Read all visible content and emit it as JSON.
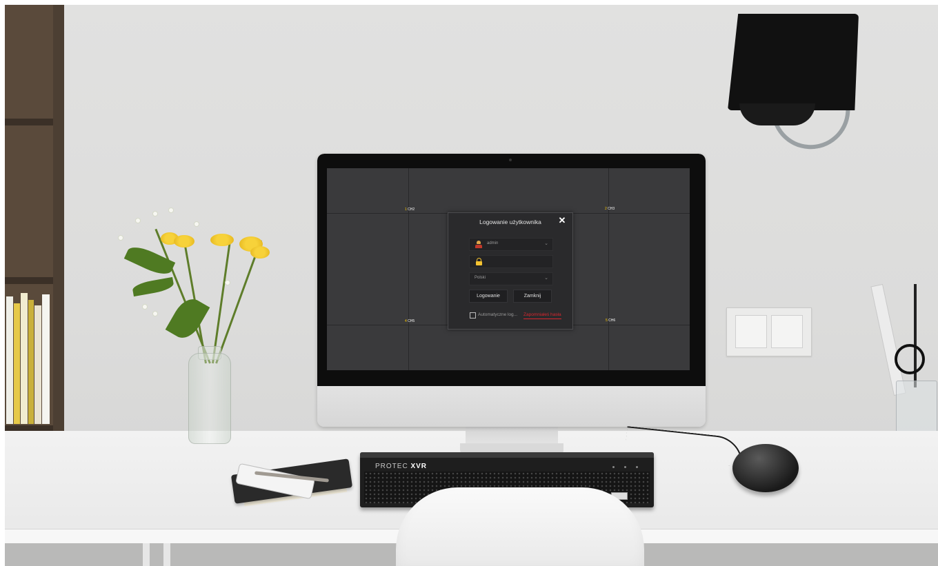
{
  "screen": {
    "channels": [
      {
        "num": "1",
        "label": "CH2"
      },
      {
        "num": "2",
        "label": "CH3"
      },
      {
        "num": "4",
        "label": "CH5"
      },
      {
        "num": "5",
        "label": "CH6"
      }
    ]
  },
  "login_dialog": {
    "title": "Logowanie użytkownika",
    "close_icon": "close-icon",
    "username": {
      "value": "admin",
      "icon": "user-icon"
    },
    "password": {
      "value": "",
      "icon": "lock-icon"
    },
    "language": {
      "value": "Polski"
    },
    "login_button": "Logowanie",
    "close_button": "Zamknij",
    "auto_login_label": "Automatyczne log...",
    "forgot_password_link": "Zapomniałeś hasła"
  },
  "device": {
    "brand": "PROTEC",
    "model": "XVR"
  },
  "colors": {
    "accent_red": "#d7262e",
    "lock_yellow": "#f5c331",
    "screen_bg": "#3a3a3c",
    "dialog_bg": "#2a2a2c"
  }
}
